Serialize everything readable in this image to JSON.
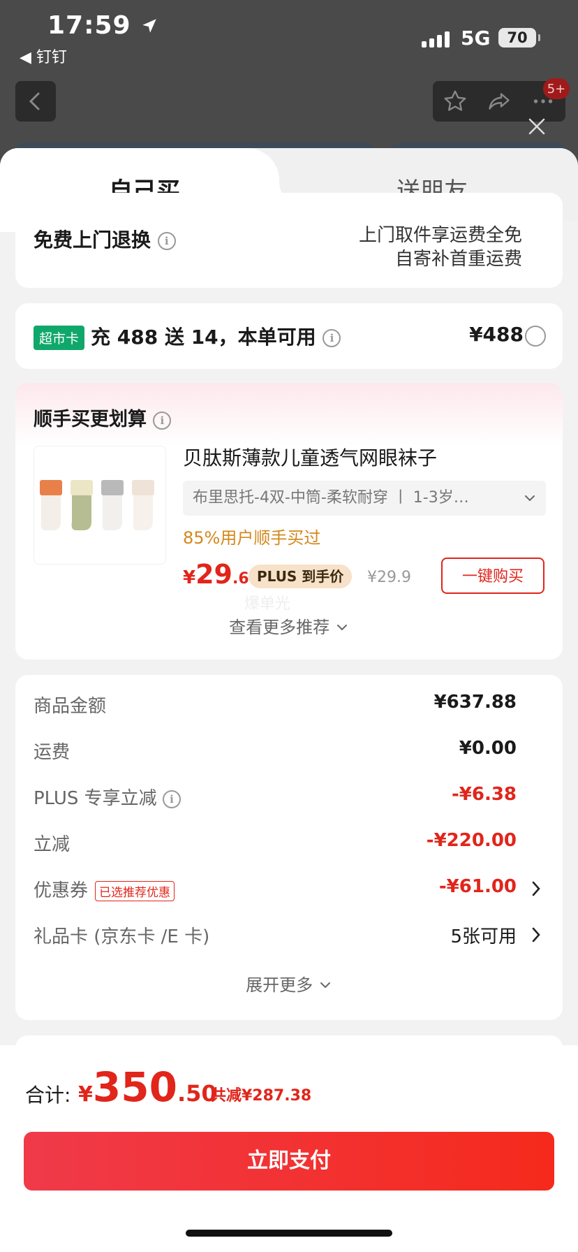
{
  "status_bar": {
    "time": "17:59",
    "back_app": "钉钉",
    "network": "5G",
    "battery": "70"
  },
  "top_nav": {
    "badge": "5+"
  },
  "tabs": {
    "self": "自己买",
    "friend": "送朋友"
  },
  "return_card": {
    "title": "免费上门退换",
    "line1": "上门取件享运费全免",
    "line2": "自寄补首重运费"
  },
  "supermarket_card": {
    "tag": "超市卡",
    "text": "充 488 送 14，本单可用",
    "price": "¥488"
  },
  "recommend": {
    "title": "顺手买更划算",
    "product_name": "贝肽斯薄款儿童透气网眼袜子",
    "spec": "布里思托-4双-中筒-柔软耐穿 丨 1-3岁…",
    "buy_rate": "85%用户顺手买过",
    "price_symbol": "¥",
    "price_int": "29",
    "price_dec": ".6",
    "plus_tag": "PLUS 到手价",
    "orig_price": "¥29.9",
    "buy_button": "一键购买",
    "watermark": "爆单光",
    "more": "查看更多推荐"
  },
  "summary": {
    "goods_label": "商品金额",
    "goods_value": "¥637.88",
    "shipping_label": "运费",
    "shipping_value": "¥0.00",
    "plus_label": "PLUS 专享立减",
    "plus_value": "-¥6.38",
    "discount_label": "立减",
    "discount_value": "-¥220.00",
    "coupon_label": "优惠券",
    "coupon_tag": "已选推荐优惠",
    "coupon_value": "-¥61.00",
    "giftcard_label": "礼品卡 (京东卡 /E 卡)",
    "giftcard_value": "5张可用",
    "expand": "展开更多"
  },
  "bottom": {
    "total_label": "合计:",
    "total_symbol": "¥",
    "total_int": "350",
    "total_dec": ".50",
    "savings": "共减¥287.38",
    "pay_button": "立即支付"
  },
  "colors": {
    "accent_red": "#e1251b",
    "supermarket_green": "#0fa86a",
    "recommend_orange": "#d4881c"
  }
}
